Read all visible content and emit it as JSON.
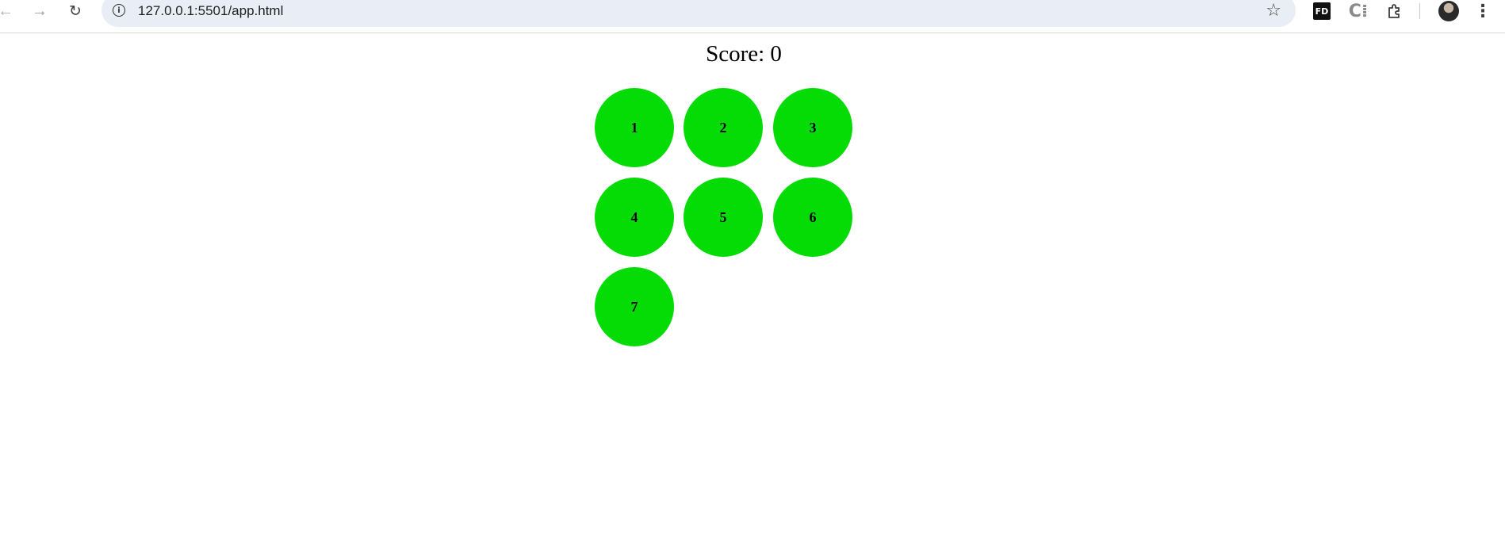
{
  "browser": {
    "url": "127.0.0.1:5501/app.html",
    "icons": {
      "back": "arrow-left-icon",
      "forward": "arrow-right-icon",
      "reload": "reload-icon",
      "site_info": "info-icon",
      "bookmark": "star-icon",
      "extension_fd": "FD",
      "extension_c": "C⁞",
      "extensions": "puzzle-icon",
      "menu": "kebab-menu-icon"
    }
  },
  "game": {
    "score_label": "Score: 0",
    "ball_color": "#05dc05",
    "balls": [
      "1",
      "2",
      "3",
      "4",
      "5",
      "6",
      "7"
    ]
  }
}
